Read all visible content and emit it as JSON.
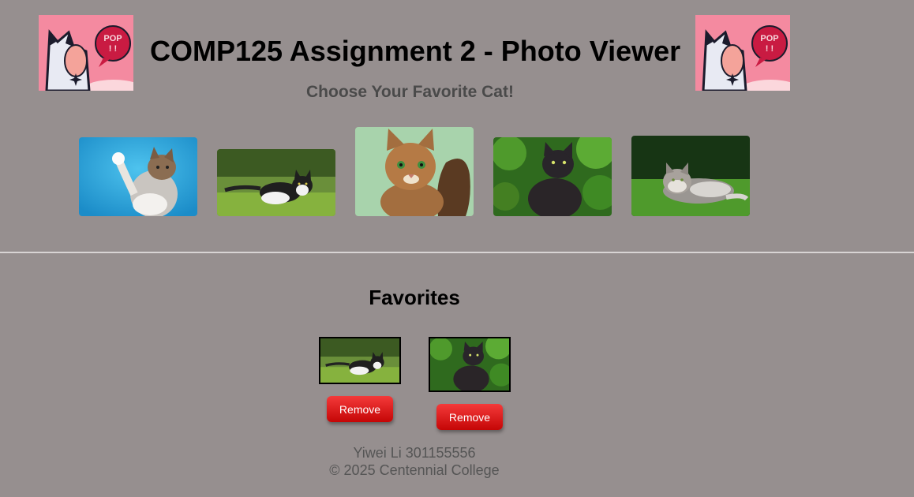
{
  "header": {
    "title": "COMP125 Assignment 2 - Photo Viewer",
    "subtitle": "Choose Your Favorite Cat!",
    "logo_text": "POP"
  },
  "gallery": {
    "photos": [
      {
        "subject": "tabby-white cat raising paw on blue background"
      },
      {
        "subject": "black and white cat walking in grass"
      },
      {
        "subject": "orange tabby cat on green background"
      },
      {
        "subject": "long-haired black cat in garden"
      },
      {
        "subject": "grey long-haired cat lying on lawn"
      }
    ]
  },
  "favorites": {
    "heading": "Favorites",
    "items": [
      {
        "photo": "black and white cat walking in grass",
        "remove_label": "Remove"
      },
      {
        "photo": "long-haired black cat in garden",
        "remove_label": "Remove"
      }
    ]
  },
  "footer": {
    "author": "Yiwei Li 301155556",
    "copyright": "© 2025 Centennial College"
  },
  "colors": {
    "background": "#968f8f",
    "remove_button": "#e01313",
    "logo_pink": "#f48aa0"
  }
}
